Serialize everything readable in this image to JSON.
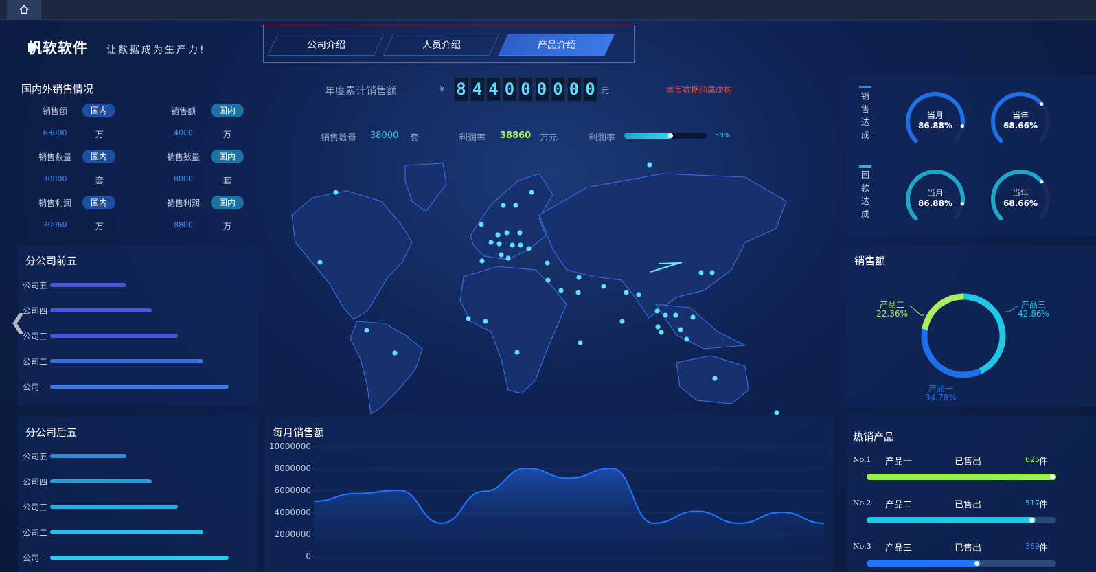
{
  "header": {
    "brand": "帆软软件",
    "slogan": "让数据成为生产力!",
    "tabs": [
      {
        "label": "公司介绍",
        "active": false
      },
      {
        "label": "人员介绍",
        "active": false
      },
      {
        "label": "产品介绍",
        "active": true
      }
    ]
  },
  "domestic_sales": {
    "title": "国内外销售情况",
    "rows": [
      {
        "label": "销售额",
        "tag": "国内",
        "left_value": "63000",
        "right_value": "4000",
        "unit": "万"
      },
      {
        "label": "销售数量",
        "tag": "国内",
        "left_value": "30000",
        "right_value": "8000",
        "unit": "套"
      },
      {
        "label": "销售利润",
        "tag": "国内",
        "left_value": "30060",
        "right_value": "8800",
        "unit": "万"
      }
    ]
  },
  "top5": {
    "title": "分公司前五",
    "labels": [
      "公司五",
      "公司四",
      "公司三",
      "公司二",
      "公司一"
    ],
    "values": [
      0.42,
      0.56,
      0.7,
      0.84,
      0.98
    ],
    "colors": [
      "#4a55d8",
      "#4a55d8",
      "#4a55d8",
      "#3a6ee0",
      "#3a7af0"
    ]
  },
  "bottom5": {
    "title": "分公司后五",
    "labels": [
      "公司五",
      "公司四",
      "公司三",
      "公司二",
      "公司一"
    ],
    "values": [
      0.42,
      0.56,
      0.7,
      0.84,
      0.98
    ],
    "colors": [
      "#2a8fd8",
      "#2a9cd8",
      "#2ab0e0",
      "#2ac0e8",
      "#2acdf0"
    ]
  },
  "annual": {
    "label": "年度累计销售额",
    "currency": "¥",
    "digits": [
      "8",
      "4",
      "4",
      "0",
      "0",
      "0",
      "0",
      "0",
      "0"
    ],
    "unit": "元",
    "disclaimer": "本页数据纯属虚构",
    "qty_label": "销售数量",
    "qty_value": "38000",
    "qty_unit": "套",
    "profit_label": "利润率",
    "profit_value": "38860",
    "profit_unit": "万元",
    "rate_label": "利润率",
    "rate_value": "58%",
    "rate_fraction": 0.58
  },
  "achievement": {
    "sales_title": "销售达成",
    "return_title": "回款达成",
    "gauges": [
      {
        "period": "当月",
        "value": "86.88%",
        "fraction": 0.8688,
        "color": "#1f6fe8"
      },
      {
        "period": "当年",
        "value": "68.66%",
        "fraction": 0.6866,
        "color": "#1f6fe8"
      },
      {
        "period": "当月",
        "value": "86.88%",
        "fraction": 0.8688,
        "color": "#1fa6c8"
      },
      {
        "period": "当年",
        "value": "68.66%",
        "fraction": 0.6866,
        "color": "#1fa6c8"
      }
    ]
  },
  "sales_donut": {
    "title": "销售额",
    "chart_data": {
      "type": "pie",
      "slices": [
        {
          "name": "产品一",
          "value": 34.78,
          "label": "34.78%",
          "color": "#1f6fe8"
        },
        {
          "name": "产品二",
          "value": 22.36,
          "label": "22.36%",
          "color": "#a8f060"
        },
        {
          "name": "产品三",
          "value": 42.86,
          "label": "42.86%",
          "color": "#22c7e8"
        }
      ]
    }
  },
  "monthly": {
    "title": "每月销售额",
    "chart_data": {
      "type": "area",
      "ylim": [
        0,
        10000000
      ],
      "yticks": [
        "10000000",
        "8000000",
        "6000000",
        "4000000",
        "2000000",
        "0"
      ],
      "values": [
        5000000,
        5700000,
        6000000,
        3000000,
        5900000,
        8000000,
        7100000,
        8000000,
        3000000,
        4100000,
        3000000,
        4000000,
        3000000
      ],
      "color": "#1f78ff"
    }
  },
  "hot_products": {
    "title": "热销产品",
    "items": [
      {
        "rank": "No.1",
        "name": "产品一",
        "status": "已售出",
        "count": "625",
        "unit": "件",
        "fraction": 1.0,
        "color": "#9bef4a",
        "count_color": "#9bef4a"
      },
      {
        "rank": "No.2",
        "name": "产品二",
        "status": "已售出",
        "count": "517",
        "unit": "件",
        "fraction": 0.89,
        "color": "#22c7e8",
        "count_color": "#22c7e8"
      },
      {
        "rank": "No.3",
        "name": "产品三",
        "status": "已售出",
        "count": "369",
        "unit": "件",
        "fraction": 0.6,
        "color": "#1f78ff",
        "count_color": "#3a8cff"
      }
    ]
  },
  "icons": {
    "home": "home-icon",
    "prev": "chevron-left-icon"
  }
}
